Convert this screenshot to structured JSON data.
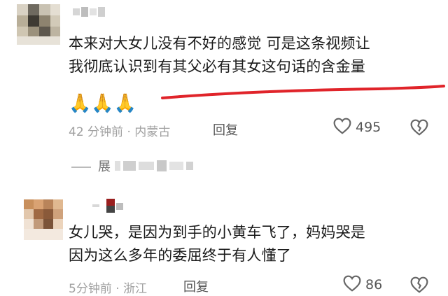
{
  "comments": [
    {
      "text_lines": [
        "本来对大女儿没有不好的感觉 可是这条视频让",
        "我彻底认识到有其父必有其女这句话的含金量"
      ],
      "emojis": "🙏🙏🙏",
      "time": "42 分钟前 · 内蒙古",
      "reply_label": "回复",
      "likes": "495"
    },
    {
      "text_lines": [
        "女儿哭，是因为到手的小黄车飞了，妈妈哭是",
        "因为这么多年的委屈终于有人懂了"
      ],
      "time": "5分钟前 · 浙江",
      "reply_label": "回复",
      "likes": "86"
    }
  ],
  "collapsed_reply": {
    "label": "展"
  },
  "colors": {
    "highlight_stroke": "#e0242a",
    "meta_gray": "#a0a0a0",
    "text": "#1a1a1a"
  },
  "icons": {
    "like": "heart-icon",
    "dislike": "broken-heart-icon",
    "reaction": "folded-hands-emoji"
  }
}
